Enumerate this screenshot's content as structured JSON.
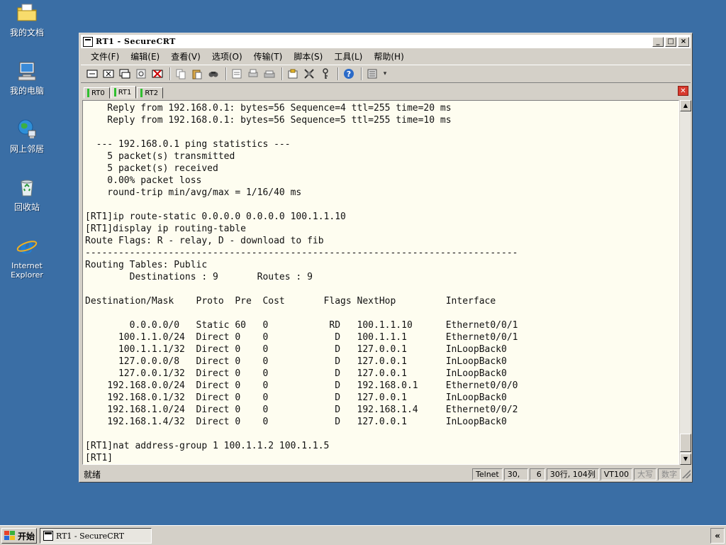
{
  "desktop": {
    "icons": [
      {
        "label": "我的文档",
        "icon": "folder-icon"
      },
      {
        "label": "我的电脑",
        "icon": "computer-icon"
      },
      {
        "label": "网上邻居",
        "icon": "network-icon"
      },
      {
        "label": "回收站",
        "icon": "recycle-bin-icon"
      },
      {
        "label": "Internet Explorer",
        "icon": "ie-icon"
      }
    ]
  },
  "window": {
    "title": "RT1 - SecureCRT",
    "min": "_",
    "max": "□",
    "close": "×"
  },
  "menu": [
    "文件(F)",
    "编辑(E)",
    "查看(V)",
    "选项(O)",
    "传输(T)",
    "脚本(S)",
    "工具(L)",
    "帮助(H)"
  ],
  "tabs": [
    {
      "label": "RT0",
      "active": false
    },
    {
      "label": "RT1",
      "active": true
    },
    {
      "label": "RT2",
      "active": false
    }
  ],
  "terminal": {
    "lines": [
      "    Reply from 192.168.0.1: bytes=56 Sequence=4 ttl=255 time=20 ms",
      "    Reply from 192.168.0.1: bytes=56 Sequence=5 ttl=255 time=10 ms",
      "",
      "  --- 192.168.0.1 ping statistics ---",
      "    5 packet(s) transmitted",
      "    5 packet(s) received",
      "    0.00% packet loss",
      "    round-trip min/avg/max = 1/16/40 ms",
      "",
      "[RT1]ip route-static 0.0.0.0 0.0.0.0 100.1.1.10",
      "[RT1]display ip routing-table",
      "Route Flags: R - relay, D - download to fib",
      "------------------------------------------------------------------------------",
      "Routing Tables: Public",
      "        Destinations : 9       Routes : 9",
      "",
      "Destination/Mask    Proto  Pre  Cost       Flags NextHop         Interface",
      "",
      "        0.0.0.0/0   Static 60   0           RD   100.1.1.10      Ethernet0/0/1",
      "      100.1.1.0/24  Direct 0    0            D   100.1.1.1       Ethernet0/0/1",
      "      100.1.1.1/32  Direct 0    0            D   127.0.0.1       InLoopBack0",
      "      127.0.0.0/8   Direct 0    0            D   127.0.0.1       InLoopBack0",
      "      127.0.0.1/32  Direct 0    0            D   127.0.0.1       InLoopBack0",
      "    192.168.0.0/24  Direct 0    0            D   192.168.0.1     Ethernet0/0/0",
      "    192.168.0.1/32  Direct 0    0            D   127.0.0.1       InLoopBack0",
      "    192.168.1.0/24  Direct 0    0            D   192.168.1.4     Ethernet0/0/2",
      "    192.168.1.4/32  Direct 0    0            D   127.0.0.1       InLoopBack0",
      "",
      "[RT1]nat address-group 1 100.1.1.2 100.1.1.5",
      "[RT1]"
    ]
  },
  "status": {
    "ready": "就绪",
    "protocol": "Telnet",
    "row": "30,",
    "col": "6",
    "size": "30行, 104列",
    "emulation": "VT100",
    "caps": "大写",
    "num": "数字"
  },
  "taskbar": {
    "start": "开始",
    "task": "RT1 - SecureCRT",
    "tray": "«"
  }
}
